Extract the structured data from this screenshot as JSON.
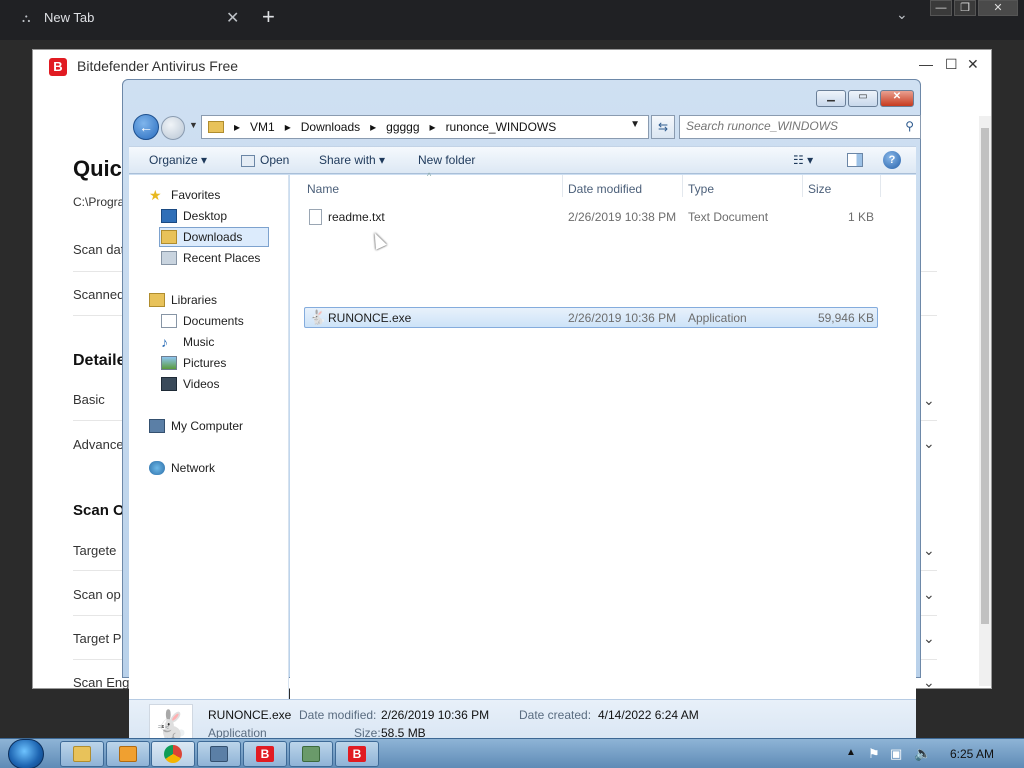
{
  "browser": {
    "tab_title": "New Tab",
    "tab_close": "✕",
    "new_tab": "+",
    "tab_search": "⌄"
  },
  "window_controls": {
    "min": "—",
    "max": "❐",
    "close": "✕"
  },
  "bitdefender": {
    "title": "Bitdefender Antivirus Free",
    "logo": "B",
    "heading": "Quic",
    "path": "C:\\Progra",
    "scan_date": "Scan dat",
    "scanned": "Scanned",
    "detailed": "Detaile",
    "basic": "Basic",
    "advanced": "Advance",
    "scan_opts_heading": "Scan O",
    "targeted": "Targete",
    "scan_op": "Scan op",
    "target_p": "Target P",
    "scan_engines": "Scan Engines Summary",
    "controls": {
      "min": "—",
      "max": "☐",
      "close": "✕"
    }
  },
  "explorer": {
    "breadcrumb": [
      "VM1",
      "Downloads",
      "ggggg",
      "runonce_WINDOWS"
    ],
    "search_placeholder": "Search runonce_WINDOWS",
    "toolbar": {
      "organize": "Organize ▾",
      "open": "Open",
      "share_with": "Share with ▾",
      "new_folder": "New folder"
    },
    "nav": {
      "favorites": "Favorites",
      "desktop": "Desktop",
      "downloads": "Downloads",
      "recent_places": "Recent Places",
      "libraries": "Libraries",
      "documents": "Documents",
      "music": "Music",
      "pictures": "Pictures",
      "videos": "Videos",
      "my_computer": "My Computer",
      "network": "Network"
    },
    "columns": {
      "name": "Name",
      "date_modified": "Date modified",
      "type": "Type",
      "size": "Size"
    },
    "files": [
      {
        "name": "readme.txt",
        "date": "2/26/2019 10:38 PM",
        "type": "Text Document",
        "size": "1 KB"
      },
      {
        "name": "RUNONCE.exe",
        "date": "2/26/2019 10:36 PM",
        "type": "Application",
        "size": "59,946 KB"
      }
    ],
    "details": {
      "name": "RUNONCE.exe",
      "kind": "Application",
      "date_modified_label": "Date modified:",
      "date_modified": "2/26/2019 10:36 PM",
      "size_label": "Size:",
      "size": "58.5 MB",
      "date_created_label": "Date created:",
      "date_created": "4/14/2022 6:24 AM"
    }
  },
  "taskbar": {
    "clock": "6:25 AM",
    "tray_arrow": "▲"
  },
  "colors": {
    "accent": "#e11b22",
    "explorer_chrome": "#cfe0f2",
    "selection": "#cde3f8"
  }
}
